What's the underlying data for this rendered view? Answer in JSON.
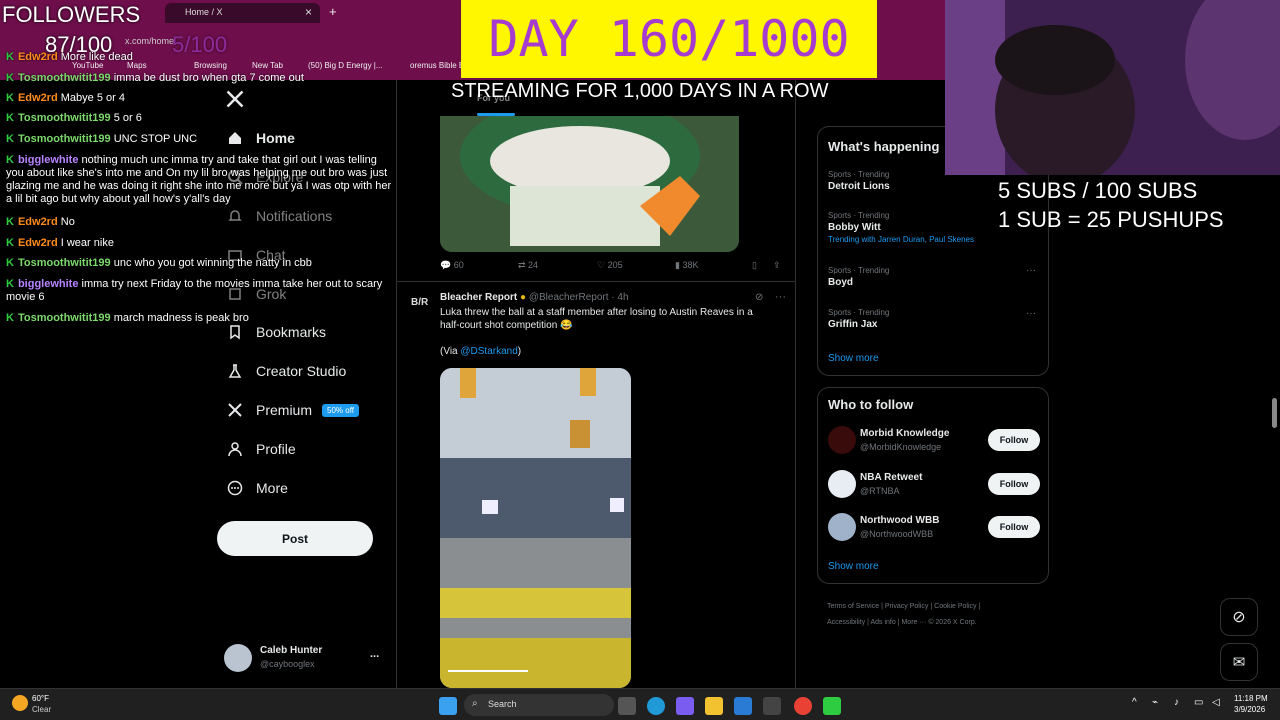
{
  "browser": {
    "tab_title": "Home / X",
    "tab_close": "×",
    "new_tab": "+",
    "url_text": "x.com/home",
    "bookmarks": [
      "YouTube",
      "Maps",
      "Browsing",
      "New Tab",
      "(50) Big D Energy |...",
      "oremus Bible B"
    ]
  },
  "nav": {
    "home": "Home",
    "explore": "Explore",
    "notifications": "Notifications",
    "chat": "Chat",
    "grok": "Grok",
    "bookmarks": "Bookmarks",
    "creator_studio": "Creator Studio",
    "premium": "Premium",
    "premium_badge": "50% off",
    "profile": "Profile",
    "more": "More",
    "post": "Post"
  },
  "account": {
    "name": "Caleb Hunter",
    "handle": "@caybooglex",
    "menu": "..."
  },
  "feed": {
    "tab_for_you": "For you",
    "first_post_stats": {
      "replies": "60",
      "reposts": "24",
      "likes": "205",
      "views": "38K"
    },
    "post": {
      "author": "Bleacher Report",
      "handle": "@BleacherReport",
      "time": "· 4h",
      "logo": "B/R",
      "text": "Luka threw the ball at a staff member after losing to Austin Reaves in a half-court shot competition 😂",
      "via_prefix": "(Via ",
      "via_handle": "@DStarkand",
      "via_suffix": ")"
    }
  },
  "sidebar": {
    "happening_title": "What's happening",
    "trends": [
      {
        "category": "Sports · Trending",
        "name": "Detroit Lions",
        "extra": ""
      },
      {
        "category": "Sports · Trending",
        "name": "Bobby Witt",
        "extra": "Trending with Jarren Duran, Paul Skenes"
      },
      {
        "category": "Sports · Trending",
        "name": "Boyd",
        "extra": ""
      },
      {
        "category": "Sports · Trending",
        "name": "Griffin Jax",
        "extra": ""
      }
    ],
    "trend_more": "···",
    "show_more": "Show more",
    "who_to_follow_title": "Who to follow",
    "follow_suggestions": [
      {
        "name": "Morbid Knowledge",
        "handle": "@MorbidKnowledge",
        "button": "Follow"
      },
      {
        "name": "NBA Retweet",
        "handle": "@RTNBA",
        "button": "Follow"
      },
      {
        "name": "Northwood WBB",
        "handle": "@NorthwoodWBB",
        "button": "Follow"
      }
    ],
    "footer_links": [
      "Terms of Service",
      "Privacy Policy",
      "Cookie Policy",
      "Accessibility",
      "Ads info",
      "More ···",
      "© 2026 X Corp."
    ]
  },
  "overlay": {
    "followers_label": "FOLLOWERS",
    "followers_count": "87/100",
    "subs_partial": "5/100",
    "day_banner": "DAY 160/1000",
    "streaming": "STREAMING FOR 1,000 DAYS IN A ROW",
    "subs_line1": "5 SUBS / 100 SUBS",
    "subs_line2": "1 SUB = 25 PUSHUPS",
    "chat": [
      {
        "user": "Edw2rd",
        "color": "orange",
        "text": "More like dead"
      },
      {
        "user": "Tosmoothwitit199",
        "color": "green",
        "text": "imma be dust bro when gta 7 come out"
      },
      {
        "user": "Edw2rd",
        "color": "orange",
        "text": "Mabye 5 or 4"
      },
      {
        "user": "Tosmoothwitit199",
        "color": "green",
        "text": "5 or 6"
      },
      {
        "user": "Tosmoothwitit199",
        "color": "green",
        "text": "UNC STOP UNC"
      },
      {
        "user": "bigglewhite",
        "color": "purple",
        "text": "nothing much unc imma try and take that girl out I was telling you about like she's into me and On my lil bro was helping me out bro was just glazing me and he was doing it right she into me more but ya I was otp with her a lil bit ago but why about yall how's y'all's day"
      },
      {
        "user": "Edw2rd",
        "color": "orange",
        "text": "No"
      },
      {
        "user": "Edw2rd",
        "color": "orange",
        "text": "I wear nike"
      },
      {
        "user": "Tosmoothwitit199",
        "color": "green",
        "text": "unc who you got winning the natty in cbb"
      },
      {
        "user": "bigglewhite",
        "color": "purple",
        "text": "imma try next Friday to the movies imma take her out to scary movie 6"
      },
      {
        "user": "Tosmoothwitit199",
        "color": "green",
        "text": "march madness is peak bro"
      }
    ]
  },
  "taskbar": {
    "weather_temp": "60°F",
    "weather_desc": "Clear",
    "search": "Search",
    "time": "11:18 PM",
    "date": "3/9/2026"
  },
  "colors": {
    "accent": "#1d9bf0",
    "banner_bg": "#fff700",
    "banner_fg": "#a63ccf",
    "browser_bg": "#6e0f4c"
  }
}
